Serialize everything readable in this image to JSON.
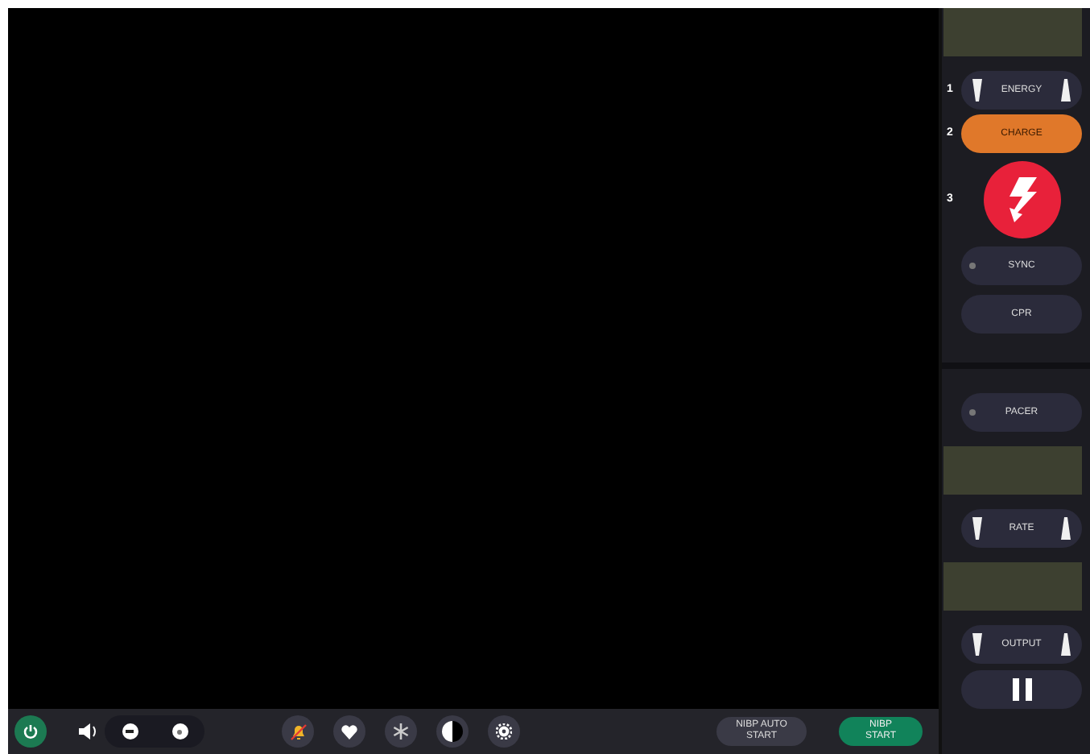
{
  "defib_panel": {
    "energy": {
      "step": "1",
      "label": "ENERGY"
    },
    "charge": {
      "step": "2",
      "label": "CHARGE"
    },
    "shock": {
      "step": "3"
    },
    "sync": {
      "label": "SYNC",
      "on": false
    },
    "cpr": {
      "label": "CPR"
    }
  },
  "pacer_panel": {
    "pacer": {
      "label": "PACER",
      "on": false
    },
    "rate": {
      "label": "RATE"
    },
    "output": {
      "label": "OUTPUT"
    }
  },
  "bottom_bar": {
    "alarms_muted": true,
    "nibp_auto": {
      "label": "NIBP AUTO\nSTART"
    },
    "nibp_start": {
      "label": "NIBP\nSTART"
    }
  }
}
